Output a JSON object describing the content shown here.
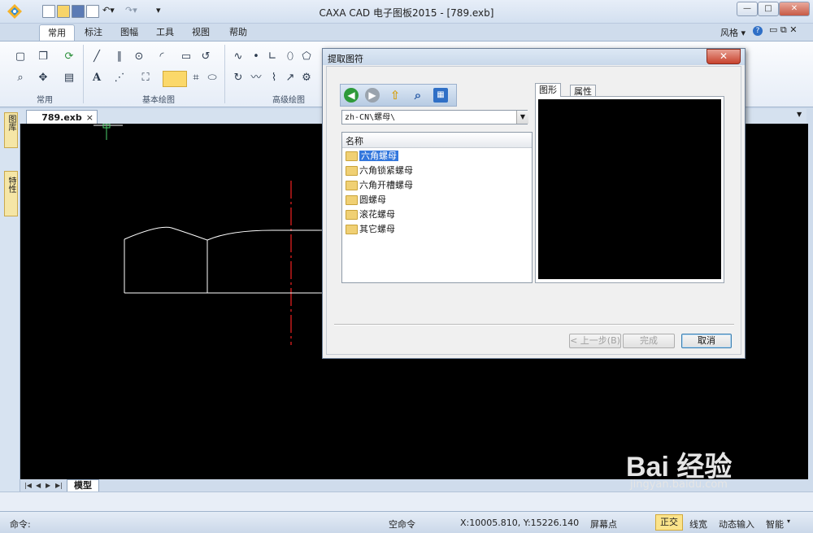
{
  "window": {
    "title": "CAXA CAD 电子图板2015 - [789.exb]",
    "style_label": "风格",
    "minimize": "—",
    "maximize": "□",
    "close": "✕"
  },
  "ribbon": {
    "tabs": [
      "常用",
      "标注",
      "图幅",
      "工具",
      "视图",
      "帮助"
    ],
    "active_tab": "常用",
    "groups": [
      "常用",
      "基本绘图",
      "高级绘图"
    ]
  },
  "document": {
    "tab": "789.exb",
    "model_tab": "模型"
  },
  "side_panel": {
    "tabs": [
      "图库",
      "特性"
    ]
  },
  "status": {
    "command_label": "命令:",
    "empty_command": "空命令",
    "coords": "X:10005.810, Y:15226.140",
    "screen_point": "屏幕点",
    "ortho": "正交",
    "line_width": "线宽",
    "dynamic_input": "动态输入",
    "smart": "智能"
  },
  "dialog": {
    "title": "提取图符",
    "path": "zh-CN\\螺母\\",
    "list_header": "名称",
    "items": [
      {
        "label": "六角螺母",
        "selected": true
      },
      {
        "label": "六角锁紧螺母",
        "selected": false
      },
      {
        "label": "六角开槽螺母",
        "selected": false
      },
      {
        "label": "圆螺母",
        "selected": false
      },
      {
        "label": "滚花螺母",
        "selected": false
      },
      {
        "label": "其它螺母",
        "selected": false
      }
    ],
    "preview_tabs": [
      "图形",
      "属性"
    ],
    "buttons": {
      "back": "< 上一步(B)",
      "finish": "完成",
      "cancel": "取消"
    }
  },
  "watermark": {
    "brand": "Bai 经验",
    "url": "jingyan.baidu.com"
  },
  "colors": {
    "accent": "#3377dd",
    "canvas": "#000000",
    "ortho_active": "#fbe38a",
    "arrow": "#2e8b3c"
  }
}
